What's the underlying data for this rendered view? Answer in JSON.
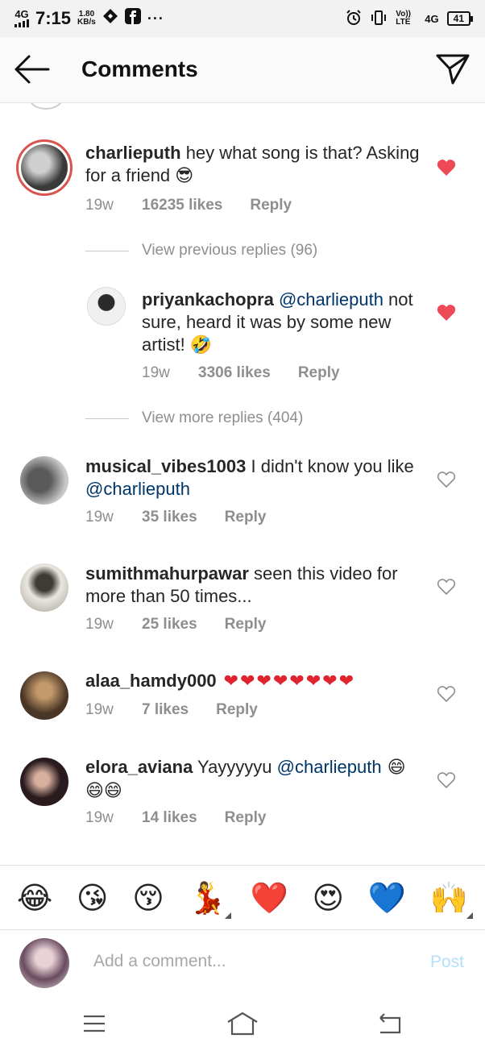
{
  "status_bar": {
    "network": "4G",
    "time": "7:15",
    "speed_value": "1.80",
    "speed_unit": "KB/s",
    "volte": "Vo)) LTE",
    "network_right": "4G",
    "battery": "41"
  },
  "header": {
    "title": "Comments",
    "back_icon": "arrow-left-icon",
    "send_icon": "paper-plane-icon"
  },
  "comments": [
    {
      "username": "charlieputh",
      "text": " hey what song is that? Asking for a friend ",
      "emoji": "😎",
      "age": "19w",
      "likes": "16235 likes",
      "reply": "Reply",
      "liked": true
    },
    {
      "username": "priyankachopra",
      "mention": "@charlieputh",
      "text": " not sure, heard it was by some new artist! ",
      "emoji": "🤣",
      "age": "19w",
      "likes": "3306 likes",
      "reply": "Reply",
      "liked": true
    },
    {
      "username": "musical_vibes1003",
      "text": " I didn't know you like ",
      "mention": "@charlieputh",
      "age": "19w",
      "likes": "35 likes",
      "reply": "Reply",
      "liked": false
    },
    {
      "username": "sumithmahurpawar",
      "text": " seen this video for more than 50 times...",
      "age": "19w",
      "likes": "25 likes",
      "reply": "Reply",
      "liked": false
    },
    {
      "username": "alaa_hamdy000",
      "text": " ❤❤❤❤❤❤❤❤",
      "age": "19w",
      "likes": "7 likes",
      "reply": "Reply",
      "liked": false
    },
    {
      "username": "elora_aviana",
      "text": " Yayyyyyu ",
      "mention": "@charlieputh",
      "emoji": " 😄😄😄",
      "age": "19w",
      "likes": "14 likes",
      "reply": "Reply",
      "liked": false
    }
  ],
  "view_previous_replies": "View previous replies (96)",
  "view_more_replies": "View more replies (404)",
  "emoji_bar": [
    "😂",
    "😘",
    "😚",
    "💃",
    "❤️",
    "😍",
    "💙",
    "🙌"
  ],
  "compose": {
    "placeholder": "Add a comment...",
    "post_label": "Post"
  },
  "nav": {
    "menu_icon": "menu-icon",
    "home_icon": "home-icon",
    "back_icon": "back-icon"
  },
  "colors": {
    "heart_liked": "#ed4956",
    "mention": "#003569",
    "post_disabled": "#b2dffc"
  }
}
